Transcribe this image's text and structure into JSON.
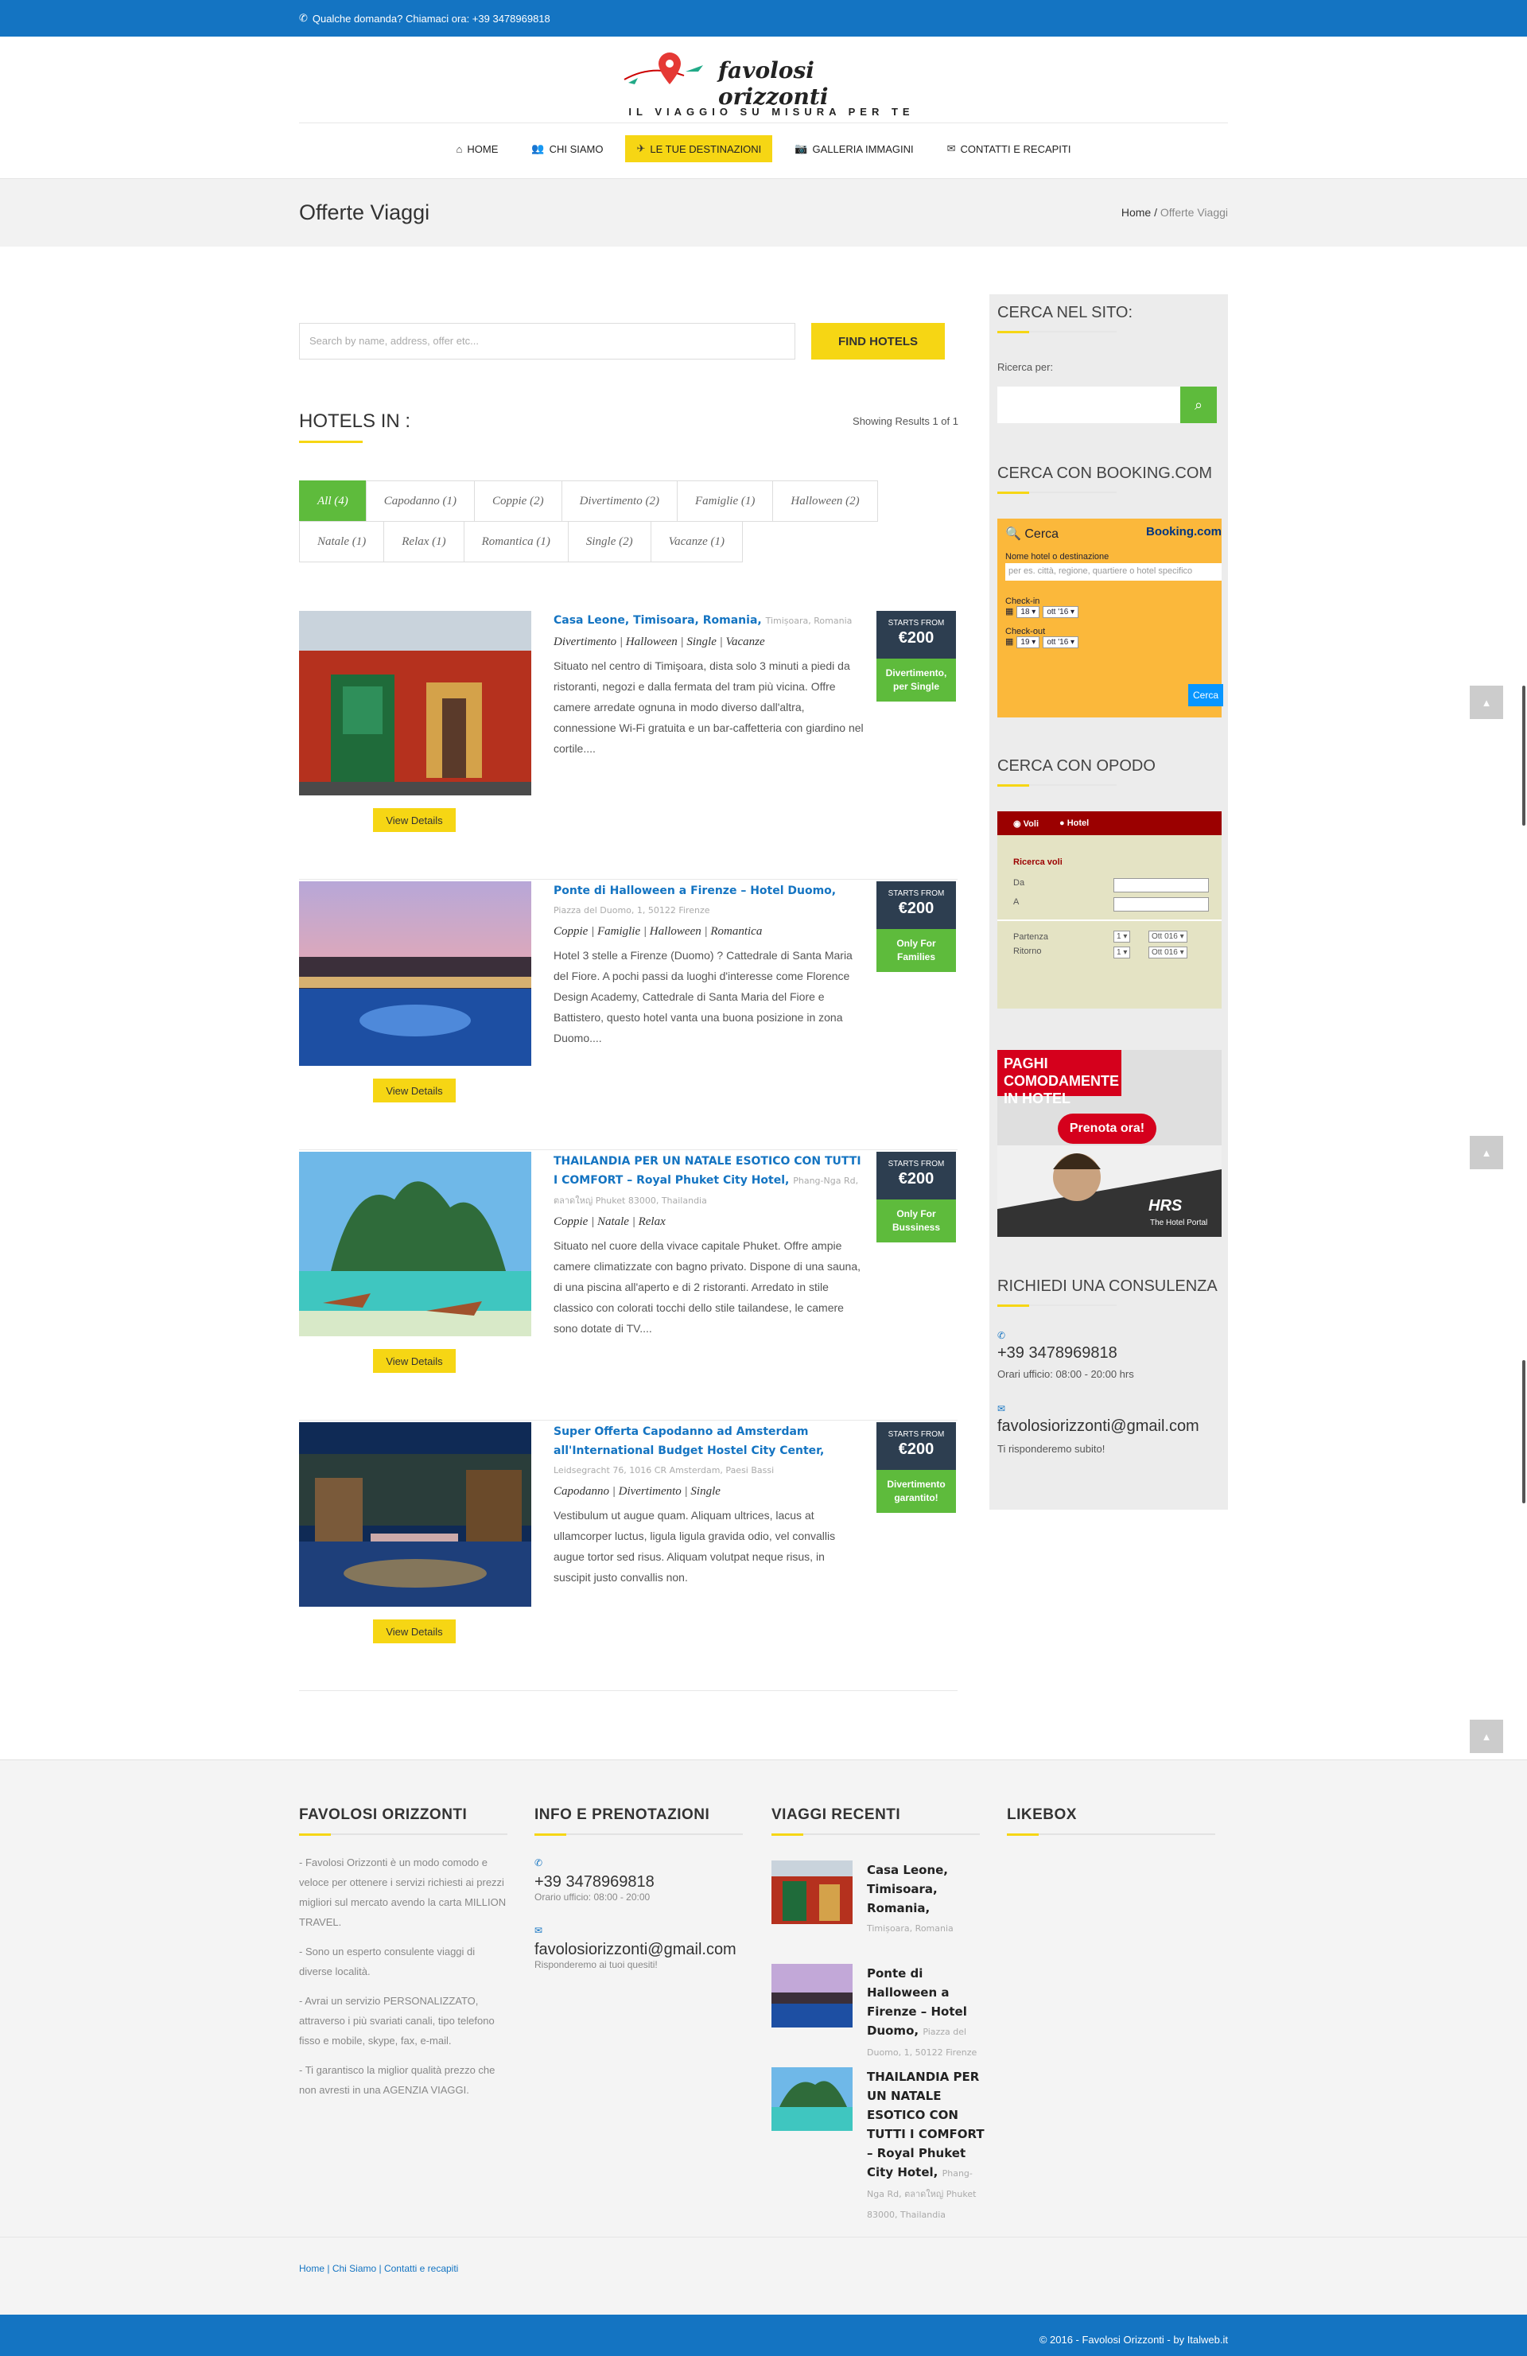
{
  "topbar": {
    "phone_text": "Qualche domanda? Chiamaci ora: +39 3478969818"
  },
  "logo": {
    "script": "favolosi orizzonti",
    "tagline": "IL VIAGGIO SU MISURA PER TE"
  },
  "nav": [
    {
      "label": "HOME",
      "icon": "home-icon"
    },
    {
      "label": "CHI SIAMO",
      "icon": "users-icon"
    },
    {
      "label": "LE TUE DESTINAZIONI",
      "icon": "plane-icon"
    },
    {
      "label": "GALLERIA IMMAGINI",
      "icon": "camera-icon"
    },
    {
      "label": "CONTATTI E RECAPITI",
      "icon": "envelope-icon"
    }
  ],
  "page": {
    "title": "Offerte Viaggi",
    "crumb_home": "Home",
    "crumb_sep": "/",
    "crumb_current": "Offerte Viaggi"
  },
  "search": {
    "placeholder": "Search by name, address, offer etc...",
    "button": "FIND HOTELS"
  },
  "results": {
    "heading": "HOTELS IN :",
    "showing": "Showing Results 1 of 1"
  },
  "filters": {
    "row1": [
      "All (4)",
      "Capodanno (1)",
      "Coppie (2)",
      "Divertimento (2)",
      "Famiglie (1)",
      "Halloween (2)"
    ],
    "row2": [
      "Natale (1)",
      "Relax (1)",
      "Romantica (1)",
      "Single (2)",
      "Vacanze (1)"
    ]
  },
  "hotels": [
    {
      "name": "Casa Leone, Timisoara, Romania,",
      "address": "Timișoara, Romania",
      "tags": "Divertimento | Halloween | Single | Vacanze",
      "desc": "Situato nel centro di Timişoara, dista solo 3 minuti a piedi da ristoranti, negozi e dalla fermata del tram più vicina. Offre camere arredate ognuna in modo diverso dall'altra, connessione Wi-Fi gratuita e un bar-caffetteria con giardino nel cortile....",
      "starts": "STARTS FROM",
      "price": "€200",
      "badge": "Divertimento, per Single",
      "button": "View Details"
    },
    {
      "name": "Ponte di Halloween a Firenze – Hotel Duomo,",
      "address": "Piazza del Duomo, 1, 50122 Firenze",
      "tags": "Coppie | Famiglie | Halloween | Romantica",
      "desc": "Hotel 3 stelle a Firenze (Duomo) ? Cattedrale di Santa Maria del Fiore. A pochi passi da luoghi d'interesse come Florence Design Academy, Cattedrale di Santa Maria del Fiore e Battistero, questo hotel vanta una buona posizione in zona Duomo....",
      "starts": "STARTS FROM",
      "price": "€200",
      "badge": "Only For Families",
      "button": "View Details"
    },
    {
      "name": "THAILANDIA PER UN NATALE ESOTICO CON TUTTI I COMFORT – Royal Phuket City Hotel,",
      "address": "Phang-Nga Rd, ตลาดใหญ่ Phuket 83000, Thailandia",
      "tags": "Coppie | Natale | Relax",
      "desc": "Situato nel cuore della vivace capitale Phuket. Offre ampie camere climatizzate con bagno privato. Dispone di una sauna, di una piscina all'aperto e di 2 ristoranti. Arredato in stile classico con colorati tocchi dello stile tailandese, le camere sono dotate di TV....",
      "starts": "STARTS FROM",
      "price": "€200",
      "badge": "Only For Bussiness",
      "button": "View Details"
    },
    {
      "name": "Super Offerta Capodanno ad Amsterdam all'International Budget Hostel City Center,",
      "address": "Leidsegracht 76, 1016 CR Amsterdam, Paesi Bassi",
      "tags": "Capodanno | Divertimento | Single",
      "desc": "Vestibulum ut augue quam. Aliquam ultrices, lacus at ullamcorper luctus, ligula ligula gravida odio, vel convallis augue tortor sed risus. Aliquam volutpat neque risus, in suscipit justo convallis non.",
      "starts": "STARTS FROM",
      "price": "€200",
      "badge": "Divertimento garantito!",
      "button": "View Details"
    }
  ],
  "sidebar": {
    "search_title": "CERCA NEL SITO:",
    "search_label": "Ricerca per:",
    "booking_title": "CERCA CON BOOKING.COM",
    "booking": {
      "cerca": "Cerca",
      "brand": "Booking.com",
      "dest_label": "Nome hotel o destinazione",
      "dest_placeholder": "per es. città, regione, quartiere o hotel specifico",
      "checkin": "Check-in",
      "checkout": "Check-out",
      "day_in": "18",
      "day_out": "19",
      "month": "ott '16",
      "button": "Cerca"
    },
    "opodo_title": "CERCA CON OPODO",
    "opodo": {
      "tab_voli": "Voli",
      "tab_hotel": "Hotel",
      "heading": "Ricerca voli",
      "da": "Da",
      "a": "A",
      "partenza": "Partenza",
      "ritorno": "Ritorno",
      "day": "1",
      "month": "Ott 016"
    },
    "ad": {
      "headline": "PAGHI COMODAMENTE IN HOTEL",
      "cta": "Prenota ora!",
      "brand": "HRS",
      "brand_sub": "The Hotel Portal"
    },
    "consult_title": "RICHIEDI UNA CONSULENZA",
    "phone": "+39 3478969818",
    "hours": "Orari ufficio: 08:00 - 20:00 hrs",
    "email": "favolosiorizzonti@gmail.com",
    "reply": "Ti risponderemo subito!"
  },
  "footer": {
    "col1_title": "FAVOLOSI ORIZZONTI",
    "col1_p1": "- Favolosi Orizzonti è un modo comodo e veloce per ottenere i servizi richiesti ai prezzi migliori sul mercato avendo la carta MILLION TRAVEL.",
    "col1_p2": "- Sono un esperto consulente viaggi di diverse località.",
    "col1_p3": "- Avrai un servizio PERSONALIZZATO, attraverso i più svariati canali, tipo telefono fisso e mobile, skype, fax, e-mail.",
    "col1_p4": "- Ti garantisco la miglior qualità prezzo che non avresti in una AGENZIA VIAGGI.",
    "col2_title": "INFO E PRENOTAZIONI",
    "col2_phone": "+39 3478969818",
    "col2_hours": "Orario ufficio: 08:00 - 20:00",
    "col2_email": "favolosiorizzonti@gmail.com",
    "col2_reply": "Risponderemo ai tuoi quesiti!",
    "col3_title": "VIAGGI RECENTI",
    "recent": [
      {
        "title": "Casa Leone, Timisoara, Romania,",
        "addr": "Timișoara, Romania"
      },
      {
        "title": "Ponte di Halloween a Firenze – Hotel Duomo,",
        "addr": "Piazza del Duomo, 1, 50122 Firenze"
      },
      {
        "title": "THAILANDIA PER UN NATALE ESOTICO CON TUTTI I COMFORT – Royal Phuket City Hotel,",
        "addr": "Phang-Nga Rd, ตลาดใหญ่ Phuket 83000, Thailandia"
      }
    ],
    "col4_title": "LIKEBOX",
    "links": [
      "Home",
      "Chi Siamo",
      "Contatti e recapiti"
    ],
    "copyright": "© 2016 - Favolosi Orizzonti - by Italweb.it"
  },
  "colors": {
    "brand_blue": "#1474c2",
    "accent_yellow": "#f6d614",
    "green": "#5ebb3c",
    "navy": "#2d3e50"
  }
}
